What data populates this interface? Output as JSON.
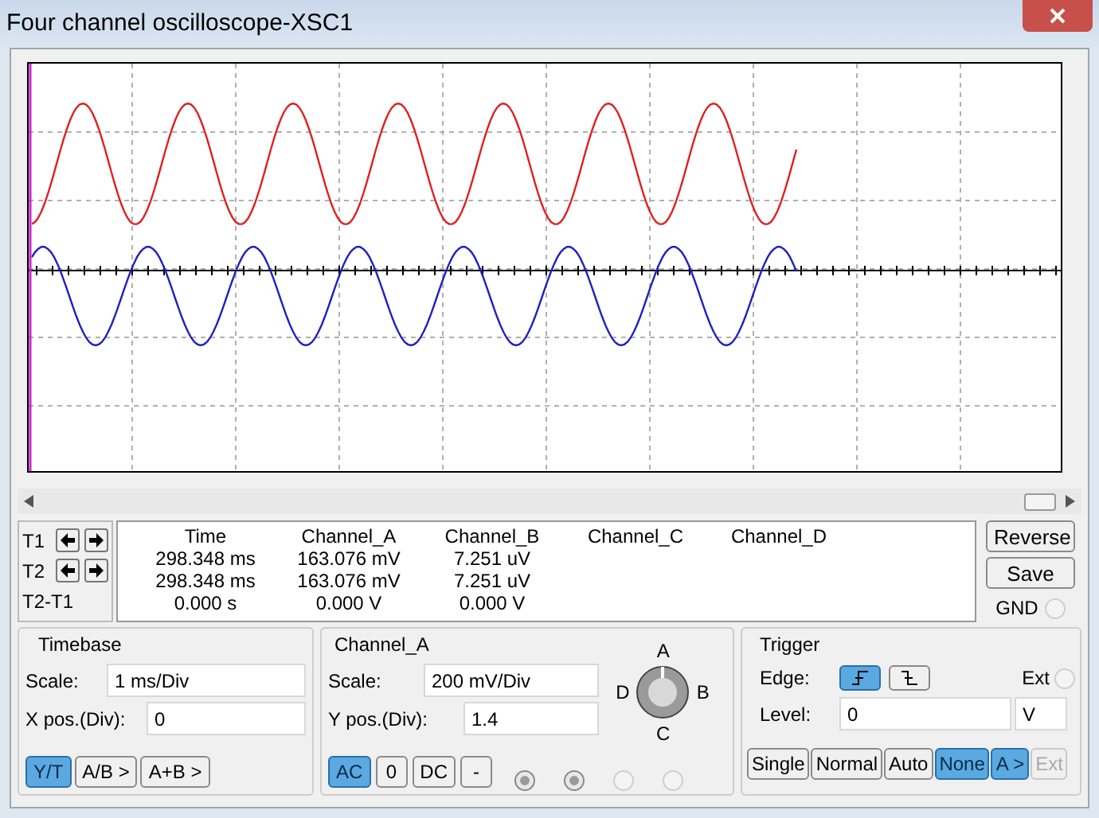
{
  "window": {
    "title": "Four channel oscilloscope-XSC1"
  },
  "readout": {
    "columns": [
      "Time",
      "Channel_A",
      "Channel_B",
      "Channel_C",
      "Channel_D"
    ],
    "rows": [
      {
        "label": "T1",
        "cells": [
          "298.348 ms",
          "163.076 mV",
          "7.251 uV"
        ]
      },
      {
        "label": "T2",
        "cells": [
          "298.348 ms",
          "163.076 mV",
          "7.251 uV"
        ]
      },
      {
        "label": "T2-T1",
        "cells": [
          "0.000 s",
          "0.000 V",
          "0.000 V"
        ]
      }
    ]
  },
  "side_buttons": [
    "Reverse",
    "Save"
  ],
  "gnd": {
    "label": "GND",
    "selected": false
  },
  "timebase": {
    "title": "Timebase",
    "fields": [
      {
        "label": "Scale:",
        "value": "1 ms/Div"
      },
      {
        "label": "X pos.(Div):",
        "value": "0"
      }
    ],
    "modes": [
      {
        "label": "Y/T",
        "selected": true
      },
      {
        "label": "A/B >",
        "selected": false
      },
      {
        "label": "A+B >",
        "selected": false
      }
    ]
  },
  "channel": {
    "title": "Channel_A",
    "fields": [
      {
        "label": "Scale:",
        "value": "200 mV/Div"
      },
      {
        "label": "Y pos.(Div):",
        "value": "1.4"
      }
    ],
    "knob_labels": [
      "A",
      "B",
      "C",
      "D"
    ],
    "couplings": [
      {
        "label": "AC",
        "selected": true
      },
      {
        "label": "0",
        "selected": false
      },
      {
        "label": "DC",
        "selected": false
      },
      {
        "label": "-",
        "selected": false
      }
    ],
    "indicators": [
      {
        "on": true
      },
      {
        "on": true
      },
      {
        "on": false
      },
      {
        "on": false
      }
    ]
  },
  "trigger": {
    "title": "Trigger",
    "edge_label": "Edge:",
    "edges": [
      {
        "kind": "rising",
        "selected": true
      },
      {
        "kind": "falling",
        "selected": false
      }
    ],
    "ext": {
      "label": "Ext",
      "selected": false
    },
    "level_label": "Level:",
    "level_value": "0",
    "level_unit": "V",
    "modes": [
      {
        "label": "Single",
        "selected": false,
        "disabled": false
      },
      {
        "label": "Normal",
        "selected": false,
        "disabled": false
      },
      {
        "label": "Auto",
        "selected": false,
        "disabled": false
      },
      {
        "label": "None",
        "selected": true,
        "disabled": false
      },
      {
        "label": "A >",
        "selected": true,
        "disabled": false
      },
      {
        "label": "Ext",
        "selected": false,
        "disabled": true
      }
    ]
  }
}
